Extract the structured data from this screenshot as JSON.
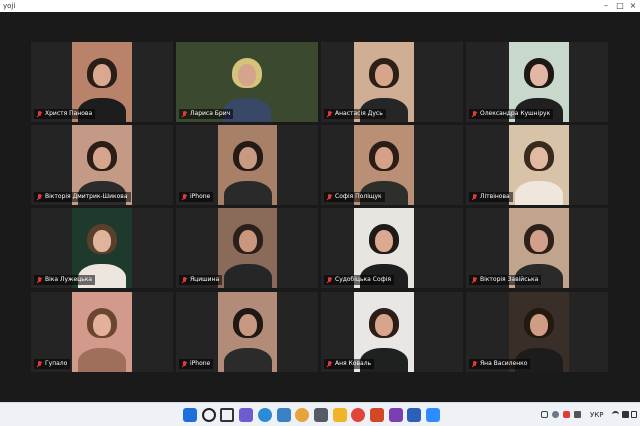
{
  "window": {
    "title": "yoji"
  },
  "participants": [
    {
      "name": "Христя Панова",
      "wall": "#b9826b",
      "hair": "#2a1e18",
      "skin": "#d9a890",
      "top": "#1d1d1d"
    },
    {
      "name": "Лариса Брич",
      "wall": "#3b4a2e",
      "hair": "#d6c27a",
      "skin": "#d4a48c",
      "top": "#3a4868"
    },
    {
      "name": "Анастасія Дусь",
      "wall": "#cfae93",
      "hair": "#2b2018",
      "skin": "#d8a58c",
      "top": "#262626"
    },
    {
      "name": "Олександра Кушнірук",
      "wall": "#c8d8cc",
      "hair": "#1e1814",
      "skin": "#e2b8a4",
      "top": "#202020"
    },
    {
      "name": "Вікторія Дмитрик-Шикова",
      "wall": "#c49a86",
      "hair": "#2a1e17",
      "skin": "#d7a48d",
      "top": "#2c2c2c"
    },
    {
      "name": "iPhone",
      "wall": "#a88068",
      "hair": "#251a14",
      "skin": "#c99a82",
      "top": "#2a2a2a"
    },
    {
      "name": "Софія Поліщук",
      "wall": "#b98f76",
      "hair": "#2a1d16",
      "skin": "#d4a088",
      "top": "#2e2f2a"
    },
    {
      "name": "Літвінова",
      "wall": "#d9c3a8",
      "hair": "#3a2a1e",
      "skin": "#e2b9a1",
      "top": "#efe6dc"
    },
    {
      "name": "Віка Лужецька",
      "wall": "#1e3a2c",
      "hair": "#5a3f2a",
      "skin": "#e0b49c",
      "top": "#ece6de"
    },
    {
      "name": "Яцишина",
      "wall": "#8a6a58",
      "hair": "#2a1f19",
      "skin": "#c9967e",
      "top": "#262626"
    },
    {
      "name": "Судобіцька Софія",
      "wall": "#e8e4e0",
      "hair": "#1e1a17",
      "skin": "#dba98f",
      "top": "#1e1e1e"
    },
    {
      "name": "Вікторія Завійська",
      "wall": "#c0a48e",
      "hair": "#2d2019",
      "skin": "#d2a08a",
      "top": "#2a2a2a"
    },
    {
      "name": "Гупало",
      "wall": "#d29a8a",
      "hair": "#6a4630",
      "skin": "#e3b09a",
      "top": "#a06f5c"
    },
    {
      "name": "iPhone",
      "wall": "#b28c78",
      "hair": "#1f1915",
      "skin": "#c89880",
      "top": "#2b2b2b"
    },
    {
      "name": "Аня Коваль",
      "wall": "#e9e6e3",
      "hair": "#2a1e16",
      "skin": "#d6a58c",
      "top": "#1f2020"
    },
    {
      "name": "Яна Василенко",
      "wall": "#3a2e28",
      "hair": "#24190f",
      "skin": "#cf9c84",
      "top": "#1c1c1c"
    }
  ],
  "taskbar": {
    "icons": [
      {
        "name": "windows-start-icon",
        "color": "#1e6fd9"
      },
      {
        "name": "search-icon",
        "color": "#222222"
      },
      {
        "name": "task-view-icon",
        "color": "#333333"
      },
      {
        "name": "chat-icon",
        "color": "#6b5ccf"
      },
      {
        "name": "edge-icon",
        "color": "#2a8bd7"
      },
      {
        "name": "photos-icon",
        "color": "#3b82c4"
      },
      {
        "name": "chrome-icon",
        "color": "#e8a33d"
      },
      {
        "name": "calculator-icon",
        "color": "#555a66"
      },
      {
        "name": "file-explorer-icon",
        "color": "#f0b429"
      },
      {
        "name": "chrome-profile-icon",
        "color": "#e0463a"
      },
      {
        "name": "powerpoint-icon",
        "color": "#d24726"
      },
      {
        "name": "onenote-icon",
        "color": "#7a3fb0"
      },
      {
        "name": "word-icon",
        "color": "#2b5fb8"
      },
      {
        "name": "zoom-icon",
        "color": "#2d8cff"
      }
    ],
    "tray": {
      "language": "УКР"
    }
  }
}
